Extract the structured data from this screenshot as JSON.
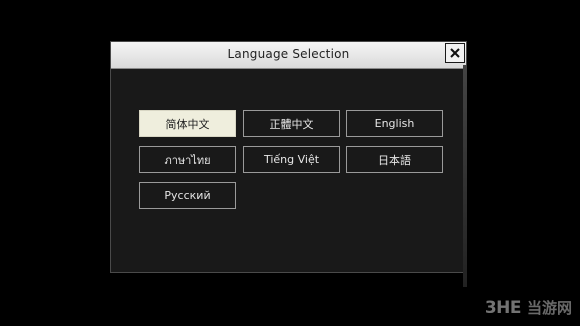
{
  "dialog": {
    "title": "Language Selection",
    "close_icon": "close-x-icon"
  },
  "languages": [
    {
      "label": "简体中文",
      "selected": true
    },
    {
      "label": "正體中文",
      "selected": false
    },
    {
      "label": "English",
      "selected": false
    },
    {
      "label": "ภาษาไทย",
      "selected": false
    },
    {
      "label": "Tiếng Việt",
      "selected": false
    },
    {
      "label": "日本語",
      "selected": false
    },
    {
      "label": "Русский",
      "selected": false
    }
  ],
  "watermark": {
    "logo": "3HE",
    "text": "当游网"
  },
  "colors": {
    "background": "#000000",
    "dialog_body": "#191919",
    "titlebar": "#e6e6e6",
    "selected_button": "#efeedd",
    "button_border": "#9a9a9a"
  }
}
